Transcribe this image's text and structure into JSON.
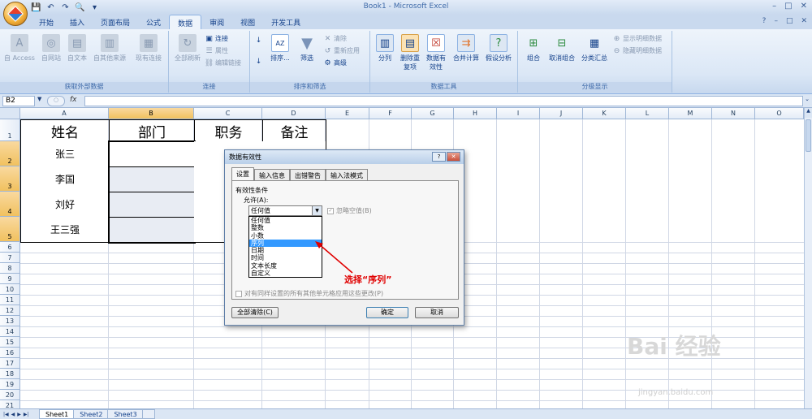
{
  "window": {
    "title": "Book1 - Microsoft Excel",
    "controls": [
      "–",
      "□",
      "✕"
    ],
    "ribbon_controls": [
      "?",
      "–",
      "□",
      "✕"
    ]
  },
  "qat": [
    "💾",
    "↶",
    "↷",
    "🔍",
    "▾"
  ],
  "tabs": [
    "开始",
    "插入",
    "页面布局",
    "公式",
    "数据",
    "审阅",
    "视图",
    "开发工具"
  ],
  "active_tab": "数据",
  "ribbon": {
    "groups": [
      {
        "label": "获取外部数据",
        "buttons": [
          "自 Access",
          "自网站",
          "自文本",
          "自其他来源",
          "现有连接"
        ]
      },
      {
        "label": "连接",
        "buttons": [
          "全部刷新"
        ],
        "small": [
          "连接",
          "属性",
          "编辑链接"
        ]
      },
      {
        "label": "排序和筛选",
        "sort_label": "排序...",
        "filter_label": "筛选",
        "small": [
          "清除",
          "重新应用",
          "高级"
        ]
      },
      {
        "label": "数据工具",
        "buttons": [
          "分列",
          "删除重复项",
          "数据有效性",
          "合并计算",
          "假设分析"
        ]
      },
      {
        "label": "分级显示",
        "buttons": [
          "组合",
          "取消组合",
          "分类汇总"
        ],
        "small": [
          "显示明细数据",
          "隐藏明细数据"
        ]
      }
    ]
  },
  "formula_bar": {
    "name_box": "B2",
    "fx": "fx",
    "value": ""
  },
  "columns": [
    "A",
    "B",
    "C",
    "D",
    "E",
    "F",
    "G",
    "H",
    "I",
    "J",
    "K",
    "L",
    "M",
    "N",
    "O"
  ],
  "rows": [
    "1",
    "2",
    "3",
    "4",
    "5",
    "6",
    "7",
    "8",
    "9",
    "10",
    "11",
    "12",
    "13",
    "14",
    "15",
    "16",
    "17",
    "18",
    "19",
    "20",
    "21"
  ],
  "table": {
    "headers": [
      "姓名",
      "部门",
      "职务",
      "备注"
    ],
    "names": [
      "张三",
      "李国",
      "刘好",
      "王三强"
    ]
  },
  "sheets": [
    "Sheet1",
    "Sheet2",
    "Sheet3"
  ],
  "active_sheet": "Sheet1",
  "dialog": {
    "title": "数据有效性",
    "title_buttons": [
      "?",
      "✕"
    ],
    "tabs": [
      "设置",
      "输入信息",
      "出错警告",
      "输入法模式"
    ],
    "active_tab": "设置",
    "section_title": "有效性条件",
    "allow_label": "允许(A):",
    "allow_value": "任何值",
    "ignore_blank": "忽略空值(B)",
    "options": [
      "任何值",
      "整数",
      "小数",
      "序列",
      "日期",
      "时间",
      "文本长度",
      "自定义"
    ],
    "selected_option": "序列",
    "apply_all": "对有同样设置的所有其他单元格应用这些更改(P)",
    "clear_all": "全部清除(C)",
    "ok": "确定",
    "cancel": "取消"
  },
  "annotation": "选择“序列”",
  "watermark": {
    "main": "Bai 经验",
    "sub": "jingyan.baidu.com"
  },
  "colors": {
    "accent": "#15428b",
    "selection": "#3399ff",
    "annotation": "#e00000"
  }
}
